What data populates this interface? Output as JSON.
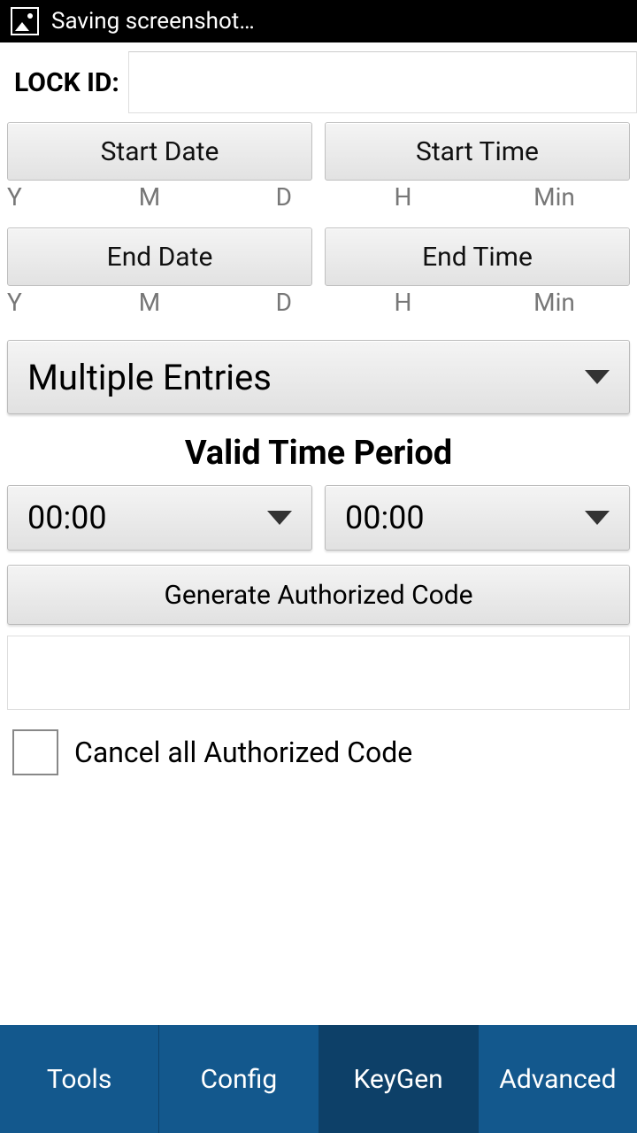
{
  "statusbar": {
    "title": "Saving screenshot…"
  },
  "lock": {
    "label": "LOCK ID:",
    "value": ""
  },
  "start": {
    "date_btn": "Start Date",
    "time_btn": "Start Time"
  },
  "end": {
    "date_btn": "End Date",
    "time_btn": "End Time"
  },
  "date_sub": {
    "y": "Y",
    "m": "M",
    "d": "D"
  },
  "time_sub": {
    "h": "H",
    "min": "Min"
  },
  "entries_dropdown": "Multiple Entries",
  "valid_period_title": "Valid Time Period",
  "period_from": "00:00",
  "period_to": "00:00",
  "generate_btn": "Generate Authorized Code",
  "output_value": "",
  "cancel_checkbox_label": "Cancel all Authorized Code",
  "nav": {
    "tools": "Tools",
    "config": "Config",
    "keygen": "KeyGen",
    "advanced": "Advanced"
  }
}
